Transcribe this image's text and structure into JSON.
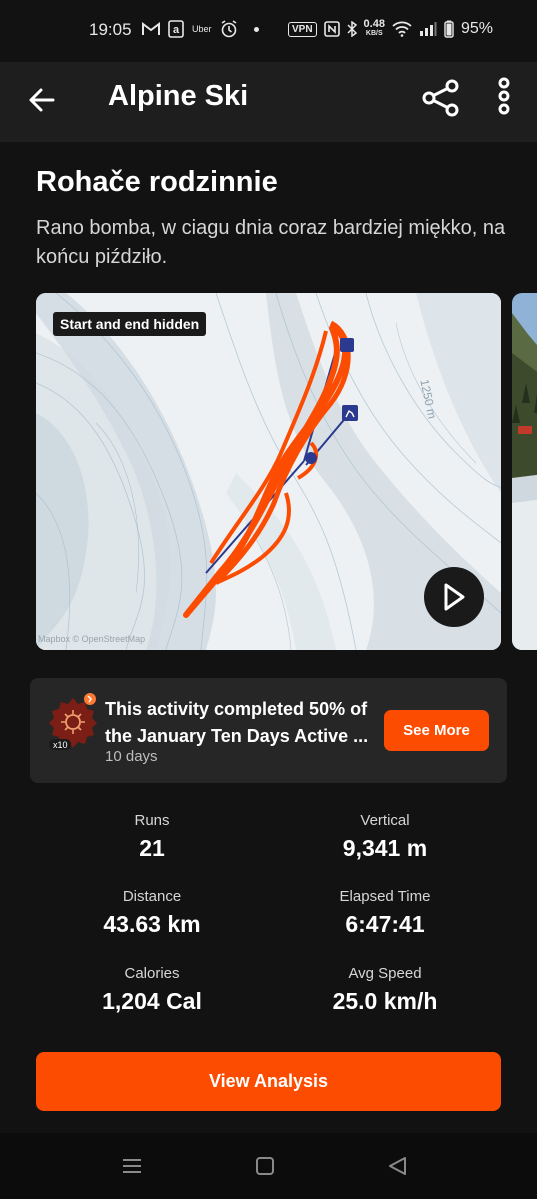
{
  "status_bar": {
    "time": "19:05",
    "left_icons": [
      "gmail-icon",
      "amazon-icon",
      "uber-icon",
      "alarm-icon",
      "dot-icon"
    ],
    "uber_text": "Uber",
    "vpn": "VPN",
    "speed_value": "0.48",
    "speed_unit": "KB/S",
    "battery": "95%"
  },
  "app_bar": {
    "title": "Alpine Ski"
  },
  "activity": {
    "title": "Rohače rodzinnie",
    "description": "Rano bomba, w ciagu dnia coraz bardziej miękko, na końcu piździło."
  },
  "map": {
    "badge": "Start and end hidden",
    "attribution": "Mapbox © OpenStreetMap",
    "elevation_label": "1250 m"
  },
  "challenge": {
    "text": "This activity completed 50% of the January Ten Days Active ...",
    "sub": "10 days",
    "badge_label": "x10",
    "button": "See More"
  },
  "stats": [
    {
      "label": "Runs",
      "value": "21"
    },
    {
      "label": "Vertical",
      "value": "9,341 m"
    },
    {
      "label": "Distance",
      "value": "43.63 km"
    },
    {
      "label": "Elapsed Time",
      "value": "6:47:41"
    },
    {
      "label": "Calories",
      "value": "1,204 Cal"
    },
    {
      "label": "Avg Speed",
      "value": "25.0 km/h"
    }
  ],
  "actions": {
    "view_analysis": "View Analysis"
  },
  "colors": {
    "accent": "#fc4c02",
    "background": "#121212",
    "app_bar": "#1e1e1e",
    "card": "#262626"
  }
}
